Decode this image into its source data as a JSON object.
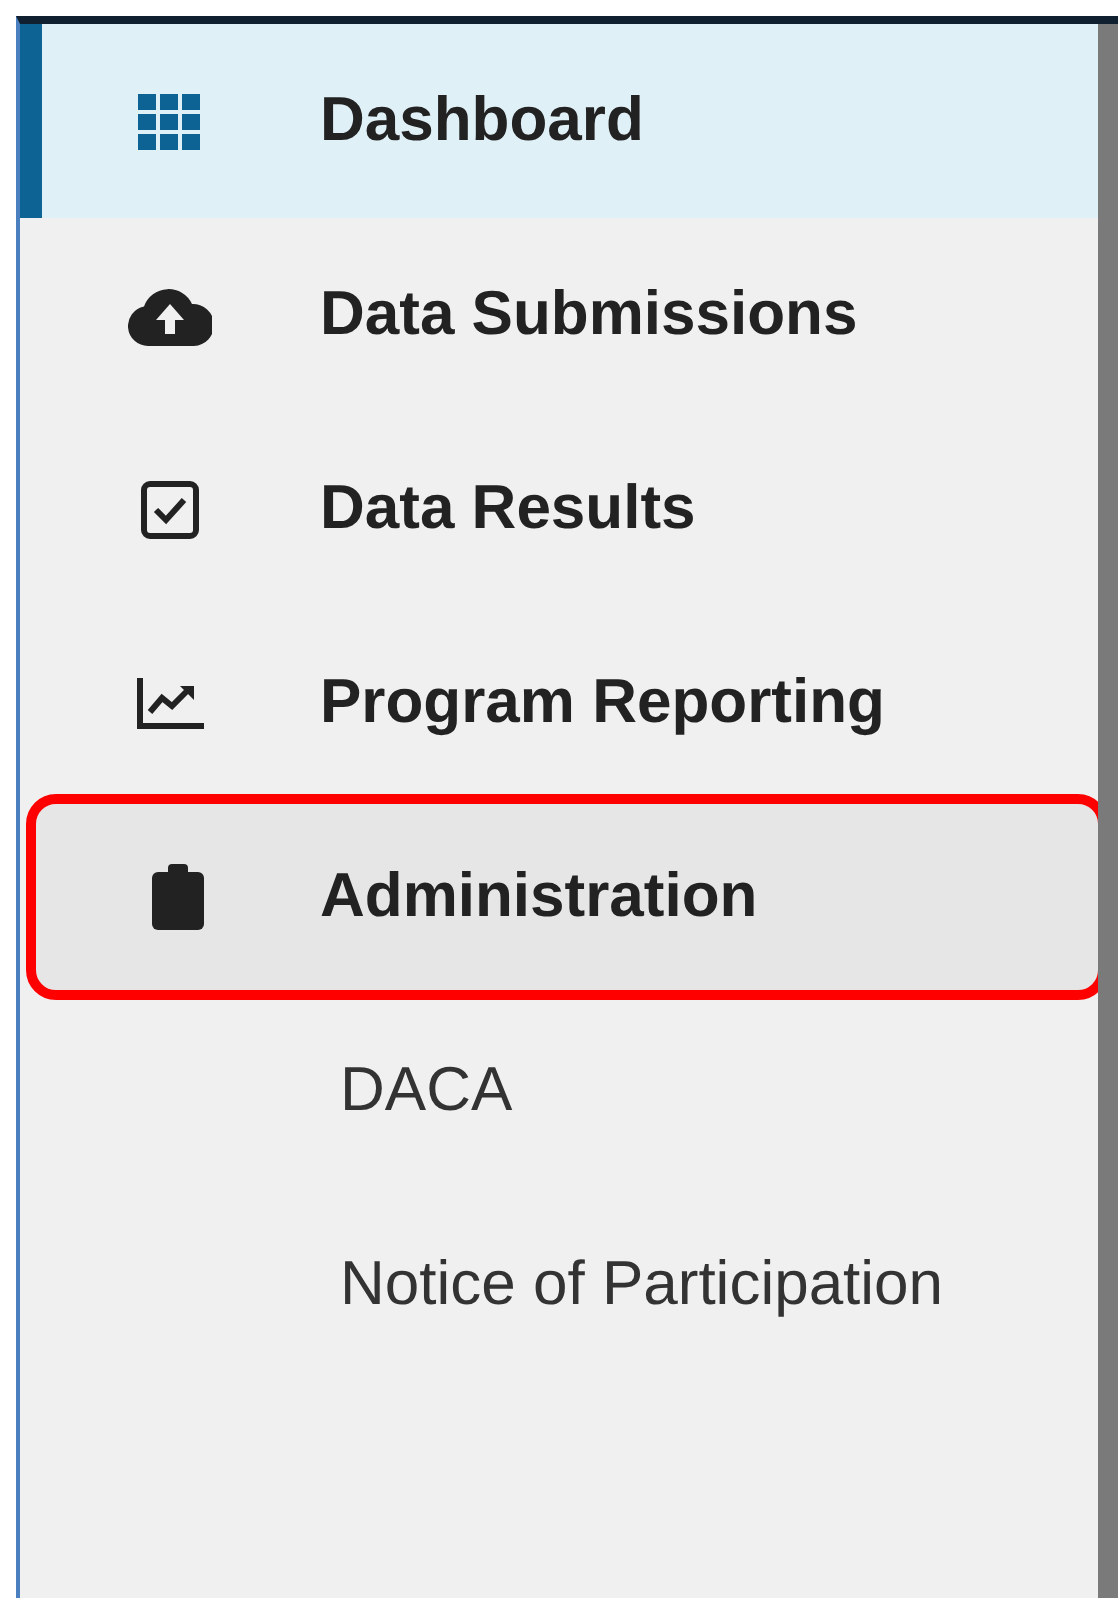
{
  "nav": [
    {
      "label": "Dashboard",
      "selected": true,
      "expanded": false,
      "highlighted": false
    },
    {
      "label": "Data Submissions",
      "selected": false,
      "expanded": false,
      "highlighted": false
    },
    {
      "label": "Data Results",
      "selected": false,
      "expanded": false,
      "highlighted": false
    },
    {
      "label": "Program Reporting",
      "selected": false,
      "expanded": false,
      "highlighted": false
    },
    {
      "label": "Administration",
      "selected": false,
      "expanded": true,
      "highlighted": true,
      "children": [
        {
          "label": "DACA"
        },
        {
          "label": "Notice of Participation"
        }
      ]
    }
  ]
}
